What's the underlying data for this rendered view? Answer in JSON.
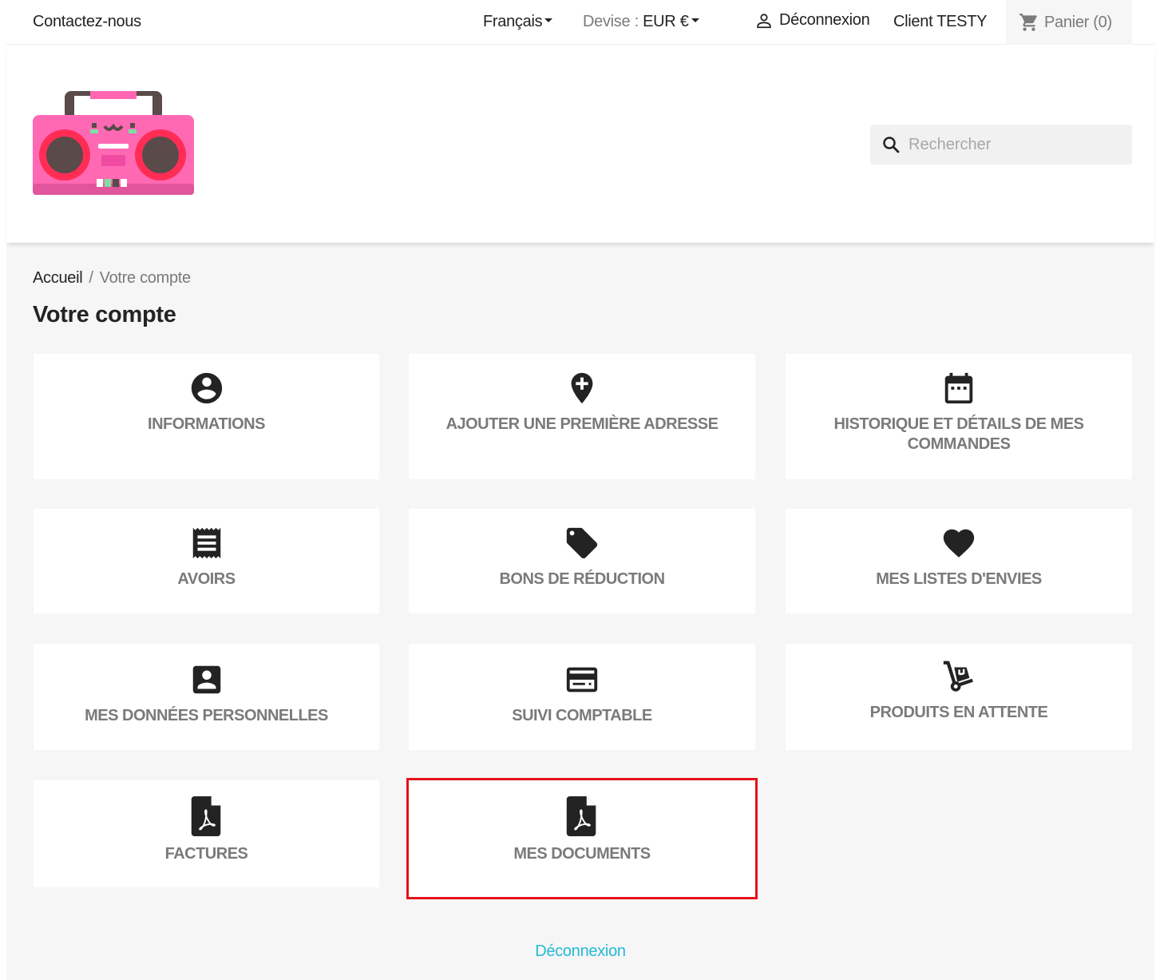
{
  "topbar": {
    "contact_label": "Contactez-nous",
    "language_label": "Français",
    "currency_prefix": "Devise :",
    "currency_value": "EUR €",
    "logout_label": "Déconnexion",
    "customer_name": "Client TESTY",
    "cart_label": "Panier (0)"
  },
  "header": {
    "search_placeholder": "Rechercher"
  },
  "breadcrumb": {
    "home": "Accueil",
    "separator": "/",
    "current": "Votre compte"
  },
  "page": {
    "title": "Votre compte"
  },
  "tiles": [
    {
      "label": "INFORMATIONS",
      "icon": "account-circle-icon"
    },
    {
      "label": "AJOUTER UNE PREMIÈRE ADRESSE",
      "icon": "add-location-icon"
    },
    {
      "label": "HISTORIQUE ET DÉTAILS DE MES COMMANDES",
      "icon": "calendar-icon"
    },
    {
      "label": "AVOIRS",
      "icon": "receipt-icon"
    },
    {
      "label": "BONS DE RÉDUCTION",
      "icon": "tag-icon"
    },
    {
      "label": "MES LISTES D'ENVIES",
      "icon": "heart-icon"
    },
    {
      "label": "MES DONNÉES PERSONNELLES",
      "icon": "account-box-icon"
    },
    {
      "label": "SUIVI COMPTABLE",
      "icon": "credit-card-icon"
    },
    {
      "label": "PRODUITS EN ATTENTE",
      "icon": "hand-truck-icon"
    },
    {
      "label": "FACTURES",
      "icon": "pdf-file-icon"
    },
    {
      "label": "MES DOCUMENTS",
      "icon": "pdf-file-icon"
    }
  ],
  "footer": {
    "logout_label": "Déconnexion"
  },
  "colors": {
    "accent": "#24b9d7",
    "highlight": "#e3121b",
    "tile_label": "#7a7a7a",
    "background": "#f6f6f6"
  }
}
